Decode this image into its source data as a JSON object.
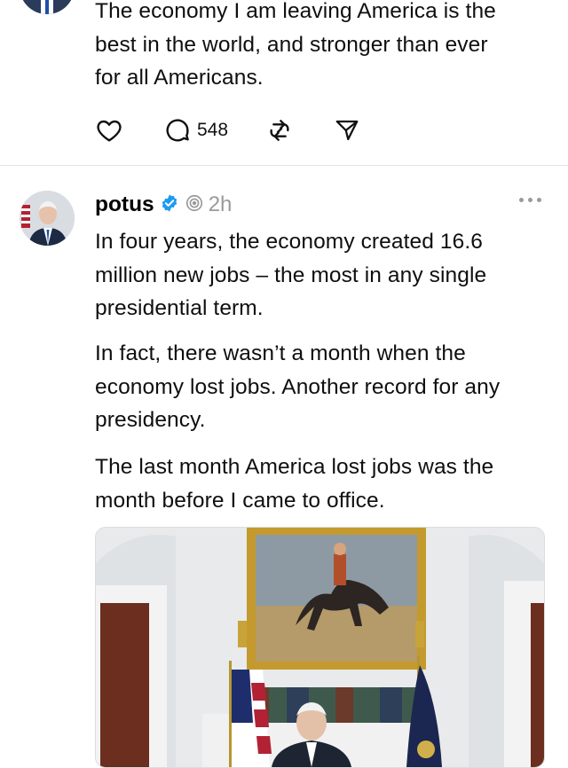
{
  "previous_post": {
    "text_lines": [
      "The economy I am leaving America is the",
      "best in the world, and stronger than ever",
      "for all Americans."
    ],
    "reply_count": "548",
    "icons": [
      "heart-icon",
      "comment-icon",
      "repost-icon",
      "share-icon"
    ]
  },
  "post": {
    "username": "potus",
    "timestamp": "2h",
    "paragraphs": [
      [
        "In four years, the economy created 16.6",
        "million new jobs – the most in any single",
        "presidential term."
      ],
      [
        "In fact, there wasn’t a month when the",
        "economy lost jobs. Another record for any",
        "presidency."
      ],
      [
        "The last month America lost jobs was the",
        "month before I came to office."
      ]
    ],
    "icons": [
      "verified-badge-icon",
      "repost-indicator-icon",
      "more-options-icon"
    ],
    "colors": {
      "verified": "#1d9bf0",
      "muted": "#9a9a9a",
      "divider": "#e5e5e5"
    }
  }
}
